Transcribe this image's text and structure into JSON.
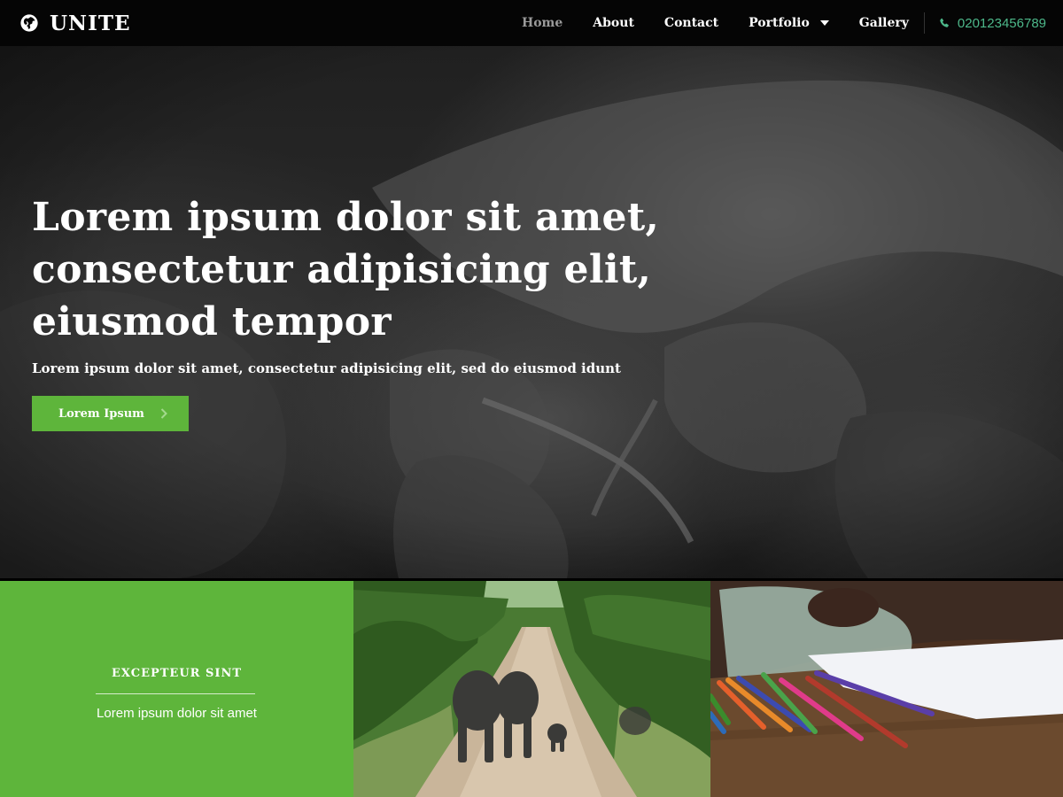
{
  "header": {
    "brand": "UNITE",
    "brand_icon": "globe-icon",
    "nav": [
      {
        "label": "Home",
        "active": true
      },
      {
        "label": "About",
        "active": false
      },
      {
        "label": "Contact",
        "active": false
      },
      {
        "label": "Portfolio",
        "active": false,
        "dropdown": true
      },
      {
        "label": "Gallery",
        "active": false
      }
    ],
    "phone": "020123456789",
    "phone_icon": "phone-icon"
  },
  "hero": {
    "title_lines": [
      "Lorem ipsum dolor sit amet,",
      "consectetur adipisicing elit,",
      "eiusmod tempor"
    ],
    "subtitle": "Lorem ipsum dolor sit amet, consectetur adipisicing elit, sed do eiusmod idunt",
    "button_label": "Lorem Ipsum",
    "button_icon": "chevron-right-icon"
  },
  "features": {
    "title": "EXCEPTEUR SINT",
    "text": "Lorem ipsum dolor sit amet"
  },
  "colors": {
    "accent_green": "#5eb53b",
    "phone_green": "#4db88a",
    "navbar_bg": "#050505",
    "active_nav": "#9a9a9a"
  }
}
